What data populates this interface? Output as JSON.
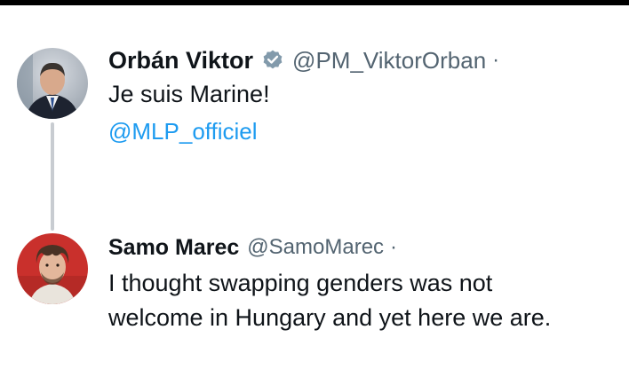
{
  "colors": {
    "name": "#0f1419",
    "handle": "#536471",
    "mention": "#1d9bf0",
    "thread_line": "#c8ccd1",
    "verified_badge": "#829aab"
  },
  "tweets": [
    {
      "display_name": "Orbán Viktor",
      "verified": true,
      "badge_icon": "verified-badge-icon",
      "handle": "@PM_ViktorOrban",
      "separator": "·",
      "text": "Je suis Marine!",
      "mention": "@MLP_officiel"
    },
    {
      "display_name": "Samo Marec",
      "verified": false,
      "handle": "@SamoMarec",
      "separator": "·",
      "text_lines": [
        "I thought swapping genders was not",
        "welcome in Hungary and yet here we are."
      ]
    }
  ]
}
